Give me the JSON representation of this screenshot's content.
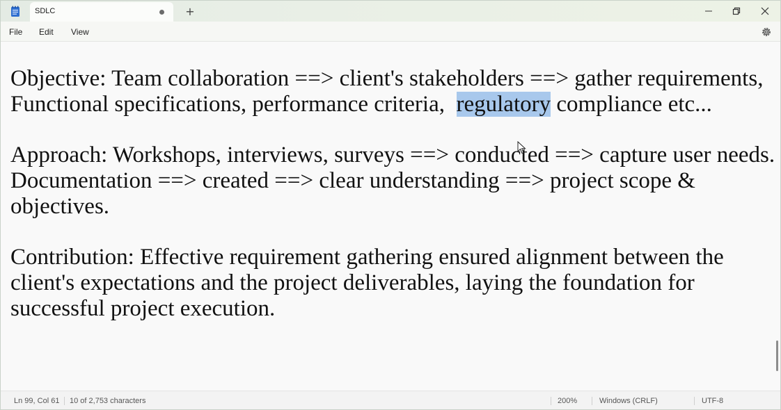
{
  "tab": {
    "title": "SDLC",
    "new_tab": "+"
  },
  "menu": {
    "file": "File",
    "edit": "Edit",
    "view": "View"
  },
  "content": {
    "p1_line1": "Objective: Team collaboration ==> client's stakeholders ==> gather requirements,",
    "p1_line2_a": "Functional specifications, performance criteria,  ",
    "p1_line2_sel": "regulatory",
    "p1_line2_b": " compliance etc...",
    "p2_line1": "Approach: Workshops, interviews, surveys ==> conducted ==> capture user needs.",
    "p2_line2": "Documentation ==> created ==> clear understanding ==> project scope &",
    "p2_line3": "objectives.",
    "p3_line1": "Contribution: Effective requirement gathering ensured alignment between the",
    "p3_line2": "client's expectations and the project deliverables, laying the foundation for",
    "p3_line3": "successful project execution."
  },
  "status": {
    "position": "Ln 99, Col 61",
    "selection": "10 of 2,753 characters",
    "zoom": "200%",
    "line_ending": "Windows (CRLF)",
    "encoding": "UTF-8"
  },
  "colors": {
    "selection": "#a8c8ec",
    "text": "#111111"
  }
}
